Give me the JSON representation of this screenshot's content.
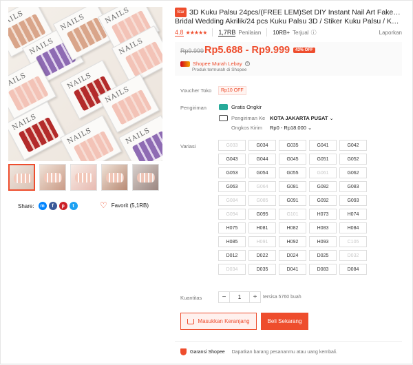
{
  "gallery": {
    "box_label": "NAILS",
    "thumbnails": [
      1,
      2,
      3,
      4,
      5
    ]
  },
  "share": {
    "label": "Share:",
    "icons": [
      "messenger-icon",
      "facebook-icon",
      "pinterest-icon",
      "twitter-icon"
    ]
  },
  "favorite": {
    "label": "Favorit (5,1RB)"
  },
  "product": {
    "badge": "Star",
    "title_line1": "3D Kuku Palsu 24pcs/(FREE LEM)Set DIY Instant Nail Art Fake Nails",
    "title_line2": "Bridal Wedding Akrilik/24 pcs Kuku Palsu 3D / Stiker Kuku Palsu / Kuku...",
    "rating": "4.8",
    "stars": "★★★★★",
    "ratings_count": "1,7RB",
    "ratings_label": "Penilaian",
    "sold_count": "10RB+",
    "sold_label": "Terjual",
    "report": "Laporkan"
  },
  "price": {
    "old": "Rp9.999",
    "current": "Rp5.688 - Rp9.999",
    "discount": "43% OFF",
    "program_name": "Shopee Murah Lebay",
    "program_sub": "Produk termurah di Shopee"
  },
  "voucher": {
    "label": "Voucher Toko",
    "value": "Rp10 OFF"
  },
  "shipping": {
    "label": "Pengiriman",
    "free": "Gratis Ongkir",
    "to_label": "Pengiriman Ke",
    "to_value": "KOTA JAKARTA PUSAT",
    "cost_label": "Ongkos Kirim",
    "cost_value": "Rp0 - Rp18.000"
  },
  "variants": {
    "label": "Variasi",
    "options": [
      {
        "name": "G033",
        "disabled": true
      },
      {
        "name": "G034",
        "disabled": false
      },
      {
        "name": "G035",
        "disabled": false
      },
      {
        "name": "G041",
        "disabled": false
      },
      {
        "name": "G042",
        "disabled": false
      },
      {
        "name": "G043",
        "disabled": false
      },
      {
        "name": "G044",
        "disabled": false
      },
      {
        "name": "G045",
        "disabled": false
      },
      {
        "name": "G051",
        "disabled": false
      },
      {
        "name": "G052",
        "disabled": false
      },
      {
        "name": "G053",
        "disabled": false
      },
      {
        "name": "G054",
        "disabled": false
      },
      {
        "name": "G055",
        "disabled": false
      },
      {
        "name": "G061",
        "disabled": true
      },
      {
        "name": "G062",
        "disabled": false
      },
      {
        "name": "G063",
        "disabled": false
      },
      {
        "name": "G064",
        "disabled": true
      },
      {
        "name": "G081",
        "disabled": false
      },
      {
        "name": "G082",
        "disabled": false
      },
      {
        "name": "G083",
        "disabled": false
      },
      {
        "name": "G084",
        "disabled": true
      },
      {
        "name": "G085",
        "disabled": true
      },
      {
        "name": "G091",
        "disabled": false
      },
      {
        "name": "G092",
        "disabled": false
      },
      {
        "name": "G093",
        "disabled": false
      },
      {
        "name": "G094",
        "disabled": true
      },
      {
        "name": "G095",
        "disabled": false
      },
      {
        "name": "G101",
        "disabled": true
      },
      {
        "name": "H073",
        "disabled": false
      },
      {
        "name": "H074",
        "disabled": false
      },
      {
        "name": "H075",
        "disabled": false
      },
      {
        "name": "H081",
        "disabled": false
      },
      {
        "name": "H082",
        "disabled": false
      },
      {
        "name": "H083",
        "disabled": false
      },
      {
        "name": "H084",
        "disabled": false
      },
      {
        "name": "H085",
        "disabled": false
      },
      {
        "name": "H091",
        "disabled": true
      },
      {
        "name": "H092",
        "disabled": false
      },
      {
        "name": "H093",
        "disabled": false
      },
      {
        "name": "C105",
        "disabled": true
      },
      {
        "name": "D012",
        "disabled": false
      },
      {
        "name": "D022",
        "disabled": false
      },
      {
        "name": "D024",
        "disabled": false
      },
      {
        "name": "D025",
        "disabled": false
      },
      {
        "name": "D032",
        "disabled": true
      },
      {
        "name": "D034",
        "disabled": true
      },
      {
        "name": "D035",
        "disabled": false
      },
      {
        "name": "D041",
        "disabled": false
      },
      {
        "name": "D083",
        "disabled": false
      },
      {
        "name": "D084",
        "disabled": false
      }
    ]
  },
  "quantity": {
    "label": "Kuantitas",
    "minus": "−",
    "value": "1",
    "plus": "+",
    "stock": "tersisa 5760 buah"
  },
  "actions": {
    "add_to_cart": "Masukkan Keranjang",
    "buy_now": "Beli Sekarang"
  },
  "guarantee": {
    "title": "Garansi Shopee",
    "desc": "Dapatkan barang pesananmu atau uang kembali."
  },
  "colors": {
    "accent": "#ee4d2d"
  }
}
